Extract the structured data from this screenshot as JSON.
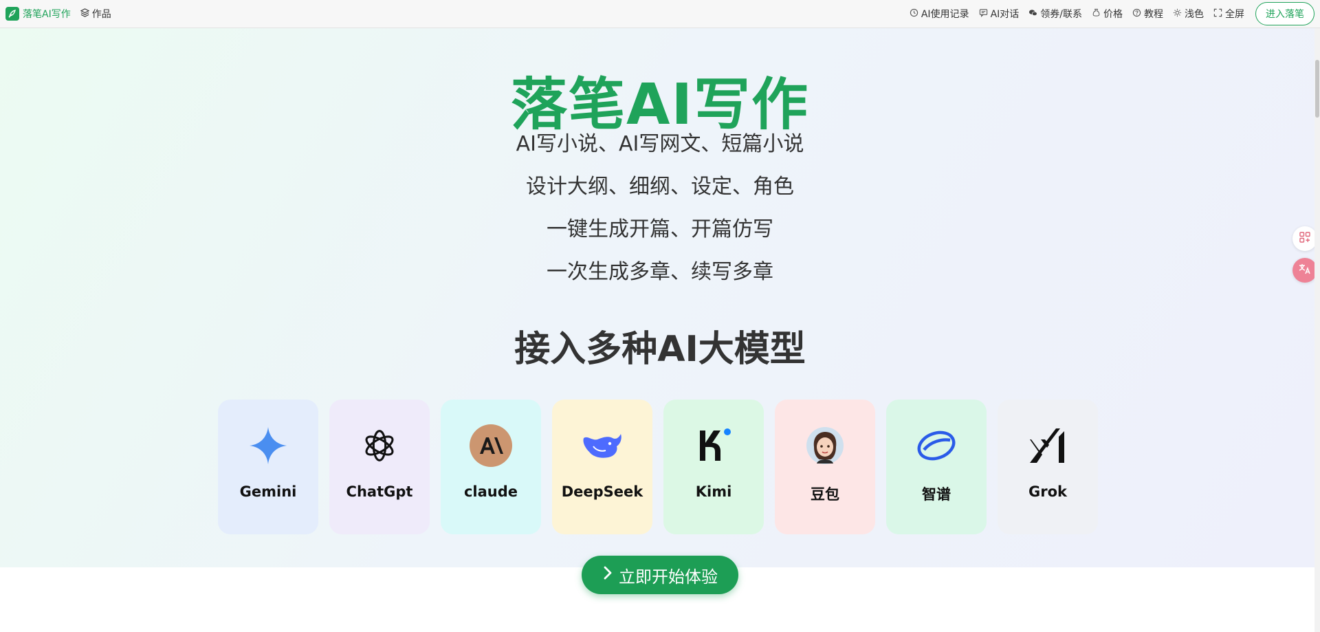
{
  "nav": {
    "brand": "落笔AI写作",
    "works": "作品",
    "items": [
      {
        "name": "history",
        "icon": "clock-icon",
        "label": "AI使用记录"
      },
      {
        "name": "chat",
        "icon": "chat-icon",
        "label": "AI对话"
      },
      {
        "name": "coupon",
        "icon": "wechat-icon",
        "label": "领券/联系"
      },
      {
        "name": "price",
        "icon": "price-icon",
        "label": "价格"
      },
      {
        "name": "tutorial",
        "icon": "help-icon",
        "label": "教程"
      },
      {
        "name": "theme",
        "icon": "sun-icon",
        "label": "浅色"
      },
      {
        "name": "fullscreen",
        "icon": "fullscreen-icon",
        "label": "全屏"
      }
    ],
    "enter_button": "进入落笔"
  },
  "hero": {
    "title": "落笔AI写作",
    "taglines": [
      "AI写小说、AI写网文、短篇小说",
      "设计大纲、细纲、设定、角色",
      "一键生成开篇、开篇仿写",
      "一次生成多章、续写多章"
    ],
    "subtitle": "接入多种AI大模型",
    "cta": "立即开始体验"
  },
  "models": [
    {
      "label": "Gemini",
      "icon": "gemini-icon",
      "bg": "#e4edfc"
    },
    {
      "label": "ChatGpt",
      "icon": "chatgpt-icon",
      "bg": "#efebfa"
    },
    {
      "label": "claude",
      "icon": "claude-icon",
      "bg": "#d9f9f9"
    },
    {
      "label": "DeepSeek",
      "icon": "deepseek-icon",
      "bg": "#fdf4d6"
    },
    {
      "label": "Kimi",
      "icon": "kimi-icon",
      "bg": "#dcf8e5"
    },
    {
      "label": "豆包",
      "icon": "doubao-icon",
      "bg": "#fde6e6"
    },
    {
      "label": "智谱",
      "icon": "zhipu-icon",
      "bg": "#daf7e8"
    },
    {
      "label": "Grok",
      "icon": "grok-icon",
      "bg": "#eff1f5"
    }
  ],
  "colors": {
    "brand_green": "#1fa35a",
    "cta_green": "#1d9e55",
    "text_dark": "#333333"
  }
}
